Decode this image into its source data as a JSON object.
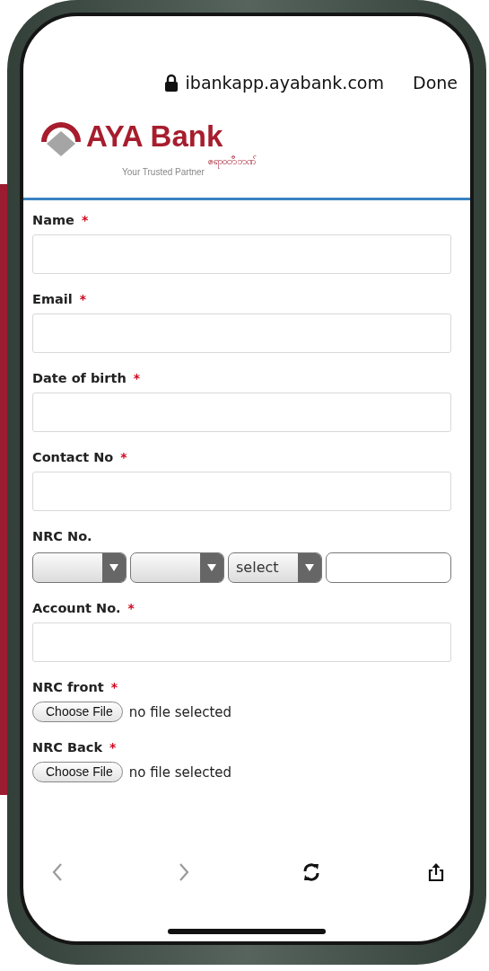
{
  "browser": {
    "url": "ibankapp.ayabank.com",
    "done": "Done"
  },
  "logo": {
    "name": "AYA Bank",
    "local_name": "ဧရာဝတီဘဏ်",
    "tagline": "Your Trusted Partner"
  },
  "fields": [
    {
      "kind": "text",
      "label": "Name",
      "required_mark": "*"
    },
    {
      "kind": "text",
      "label": "Email",
      "required_mark": "*"
    },
    {
      "kind": "text",
      "label": "Date of birth",
      "required_mark": "*"
    },
    {
      "kind": "text",
      "label": "Contact No",
      "required_mark": "*"
    },
    {
      "kind": "nrc",
      "label": "NRC No.",
      "selects": [
        {
          "kind": "dropdown"
        },
        {
          "kind": "dropdown"
        },
        {
          "kind": "dropdown",
          "value": "select"
        }
      ]
    },
    {
      "kind": "text",
      "label": "Account No.",
      "required_mark": "*"
    },
    {
      "kind": "file",
      "label": "NRC front",
      "required_mark": "*",
      "button": "Choose File",
      "status": "no file selected"
    },
    {
      "kind": "file",
      "label": "NRC Back",
      "required_mark": "*",
      "button": "Choose File",
      "status": "no file selected"
    }
  ],
  "toolbar": [
    {
      "kind": "back",
      "disabled": true
    },
    {
      "kind": "forward",
      "disabled": true
    },
    {
      "kind": "reload",
      "disabled": false
    },
    {
      "kind": "share",
      "disabled": false
    }
  ]
}
